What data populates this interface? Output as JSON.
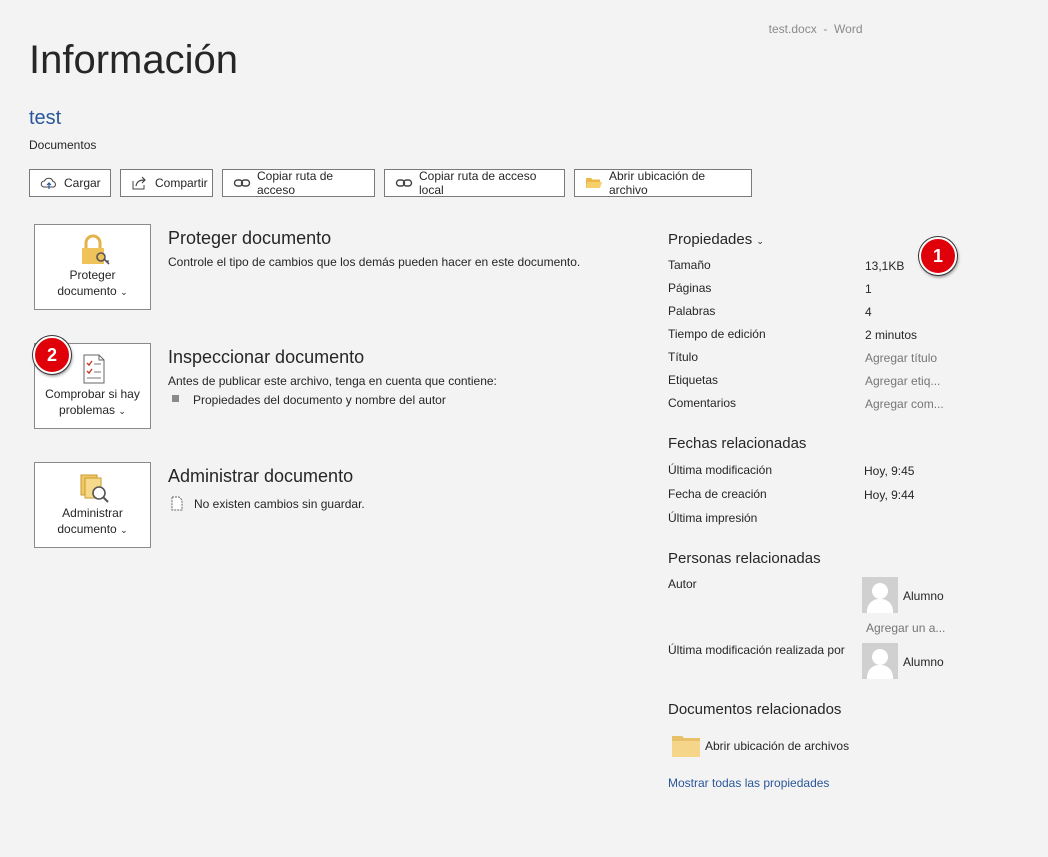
{
  "titlebar": {
    "filename": "test.docx",
    "sep": "-",
    "app": "Word"
  },
  "page_title": "Información",
  "document": {
    "name": "test",
    "location": "Documentos"
  },
  "actions": [
    {
      "label": "Cargar",
      "icon": "cloud-upload-icon"
    },
    {
      "label": "Compartir",
      "icon": "share-icon"
    },
    {
      "label": "Copiar ruta de acceso",
      "icon": "link-icon"
    },
    {
      "label": "Copiar ruta de acceso local",
      "icon": "link-icon"
    },
    {
      "label": "Abrir ubicación de archivo",
      "icon": "folder-open-icon"
    }
  ],
  "sections": {
    "protect": {
      "button_line1": "Proteger",
      "button_line2": "documento",
      "title": "Proteger documento",
      "desc": "Controle el tipo de cambios que los demás pueden hacer en este documento."
    },
    "inspect": {
      "button_line1": "Comprobar si hay",
      "button_line2": "problemas",
      "title": "Inspeccionar documento",
      "desc": "Antes de publicar este archivo, tenga en cuenta que contiene:",
      "bullet": "Propiedades del documento y nombre del autor"
    },
    "manage": {
      "button_line1": "Administrar",
      "button_line2": "documento",
      "title": "Administrar documento",
      "desc": "No existen cambios sin guardar."
    }
  },
  "badges": {
    "one": "1",
    "two": "2"
  },
  "properties": {
    "header": "Propiedades",
    "items": [
      {
        "label": "Tamaño",
        "value": "13,1KB"
      },
      {
        "label": "Páginas",
        "value": "1"
      },
      {
        "label": "Palabras",
        "value": "4"
      },
      {
        "label": "Tiempo de edición",
        "value": "2 minutos"
      },
      {
        "label": "Título",
        "value": "Agregar título"
      },
      {
        "label": "Etiquetas",
        "value": "Agregar etiq..."
      },
      {
        "label": "Comentarios",
        "value": "Agregar com..."
      }
    ]
  },
  "dates": {
    "header": "Fechas relacionadas",
    "items": [
      {
        "label": "Última modificación",
        "value": "Hoy, 9:45"
      },
      {
        "label": "Fecha de creación",
        "value": "Hoy, 9:44"
      },
      {
        "label": "Última impresión",
        "value": ""
      }
    ]
  },
  "people": {
    "header": "Personas relacionadas",
    "author_label": "Autor",
    "author_name": "Alumno",
    "add_author": "Agregar un a...",
    "modified_label": "Última modificación realizada por",
    "modified_name": "Alumno"
  },
  "related_docs": {
    "header": "Documentos relacionados",
    "open_location": "Abrir ubicación de archivos"
  },
  "show_all": "Mostrar todas las propiedades",
  "colors": {
    "accent": "#2b579a",
    "badge": "#e0000a",
    "background": "#f3f3f3"
  }
}
